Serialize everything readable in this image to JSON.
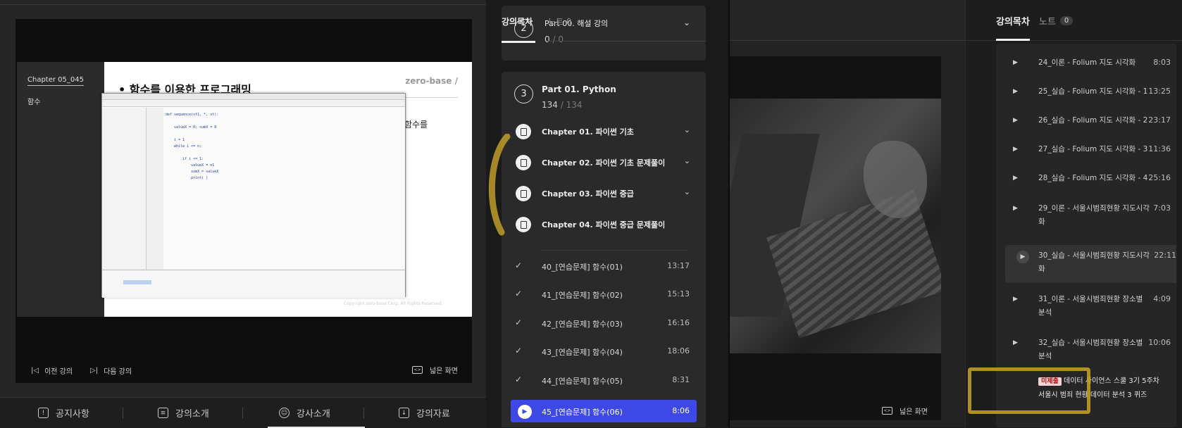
{
  "left_player": {
    "slide": {
      "chapter": "Chapter  05_045",
      "topic": "함수",
      "title": "• 함수를 이용한 프로그래밍",
      "brand": "zero-base /",
      "partial_text": "함수를",
      "copyright": "Copyright zero-base Corp. All Rights Reserved."
    },
    "controls": {
      "prev_label": "이전 강의",
      "next_label": "다음 강의",
      "wide_label": "넓은 화면"
    },
    "tabs": [
      {
        "label": "공지사항",
        "icon": "notice-icon"
      },
      {
        "label": "강의소개",
        "icon": "clipboard-icon"
      },
      {
        "label": "강사소개",
        "icon": "person-icon"
      },
      {
        "label": "강의자료",
        "icon": "download-doc-icon"
      }
    ]
  },
  "middle_curriculum": {
    "tab_overlay": "강의목차",
    "tab_overlay_2": "노트  0",
    "top_part": {
      "number": "2",
      "title": "Part 00. 해설 강의",
      "done": "0",
      "total": "/ 0"
    },
    "part": {
      "number": "3",
      "title": "Part 01. Python",
      "done": "134",
      "total": "/ 134"
    },
    "chapters": [
      {
        "label": "Chapter 01. 파이썬 기초",
        "expandable": true
      },
      {
        "label": "Chapter 02. 파이썬 기초 문제풀이",
        "expandable": true
      },
      {
        "label": "Chapter 03. 파이썬 중급",
        "expandable": true
      },
      {
        "label": "Chapter 04. 파이썬 중급 문제풀이",
        "expandable": false
      }
    ],
    "lessons": [
      {
        "title": "40_[연습문제] 함수(01)",
        "time": "13:17",
        "active": false
      },
      {
        "title": "41_[연습문제] 함수(02)",
        "time": "15:13",
        "active": false
      },
      {
        "title": "42_[연습문제] 함수(03)",
        "time": "16:16",
        "active": false
      },
      {
        "title": "43_[연습문제] 함수(04)",
        "time": "18:06",
        "active": false
      },
      {
        "title": "44_[연습문제] 함수(05)",
        "time": "8:31",
        "active": false
      },
      {
        "title": "45_[연습문제] 함수(06)",
        "time": "8:06",
        "active": true
      }
    ]
  },
  "right_panel": {
    "wide_label": "넓은 화면",
    "tabs": {
      "toc": "강의목차",
      "notes": "노트",
      "notes_count": "0"
    },
    "lessons": [
      {
        "title": "24_이론 - Folium 지도 시각화",
        "time": "8:03"
      },
      {
        "title": "25_실습 - Folium 지도 시각화 - 1",
        "time": "13:25"
      },
      {
        "title": "26_실습 - Folium 지도 시각화 - 2",
        "time": "23:17"
      },
      {
        "title": "27_실습 - Folium 지도 시각화 - 3",
        "time": "11:36"
      },
      {
        "title": "28_실습 - Folium 지도 시각화 - 4",
        "time": "25:16"
      },
      {
        "title": "29_이론 - 서울시범죄현황 지도시각화",
        "time": "7:03"
      },
      {
        "title": "30_실습 - 서울시범죄현황 지도시각화",
        "time": "22:11",
        "active": true
      },
      {
        "title": "31_이론 - 서울시범죄현황 장소별 분석",
        "time": "4:09"
      },
      {
        "title": "32_실습 - 서울시범죄현황 장소별 분석",
        "time": "10:06"
      }
    ],
    "quiz": {
      "badge": "미제출",
      "title": "데이터 사이언스 스쿨 3기 5주차 서울시 범죄 현황 데이터 분석 3 퀴즈"
    }
  },
  "colors": {
    "accent_active": "#3d48e6",
    "highlight_marker": "#c9a52a",
    "badge_bg": "#f3d3d3",
    "badge_fg": "#b01010"
  }
}
